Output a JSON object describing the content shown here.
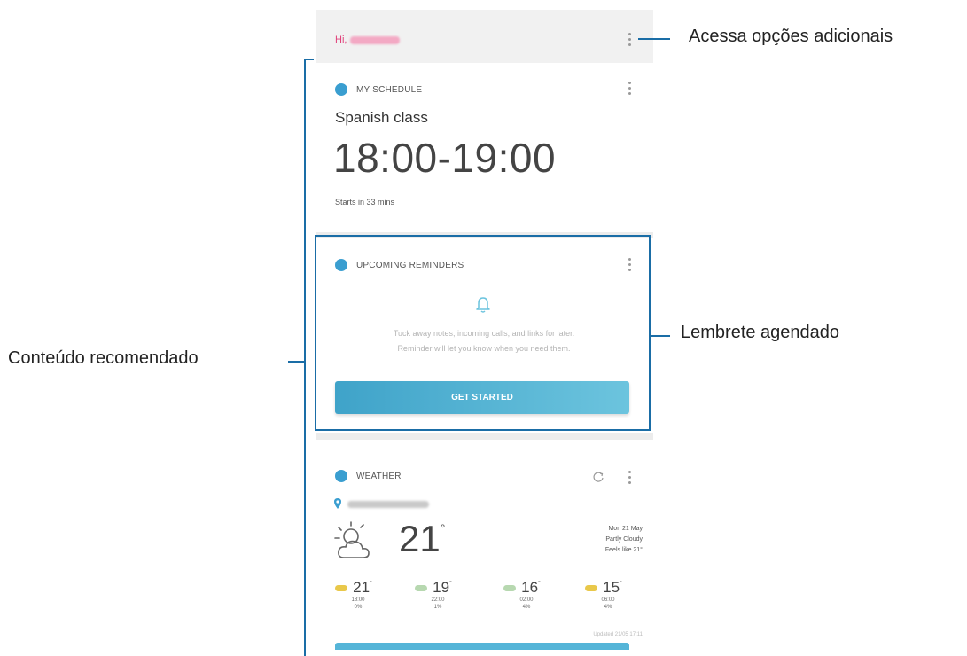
{
  "greeting": {
    "label": "Hi,"
  },
  "schedule": {
    "title": "MY SCHEDULE",
    "event": "Spanish class",
    "time": "18:00-19:00",
    "starts": "Starts in 33 mins"
  },
  "reminders": {
    "title": "UPCOMING REMINDERS",
    "line1": "Tuck away notes, incoming calls, and links for later.",
    "line2": "Reminder will let you know when you need them.",
    "button": "GET STARTED"
  },
  "weather": {
    "title": "WEATHER",
    "temp": "21",
    "date": "Mon 21 May",
    "condition": "Partly Cloudy",
    "feels": "Feels like 21°",
    "forecast": [
      {
        "temp": "21",
        "time": "18:00",
        "pct": "0%"
      },
      {
        "temp": "19",
        "time": "22:00",
        "pct": "1%"
      },
      {
        "temp": "16",
        "time": "02:00",
        "pct": "4%"
      },
      {
        "temp": "15",
        "time": "06:00",
        "pct": "4%"
      }
    ],
    "updated": "Updated 21/05 17:11"
  },
  "annotations": {
    "more": "Acessa opções adicionais",
    "reminder": "Lembrete agendado",
    "recommended": "Conteúdo recomendado"
  },
  "colors": {
    "accent": "#1a6da6",
    "button": "#4fb0d6",
    "greeting": "#e0407a"
  }
}
